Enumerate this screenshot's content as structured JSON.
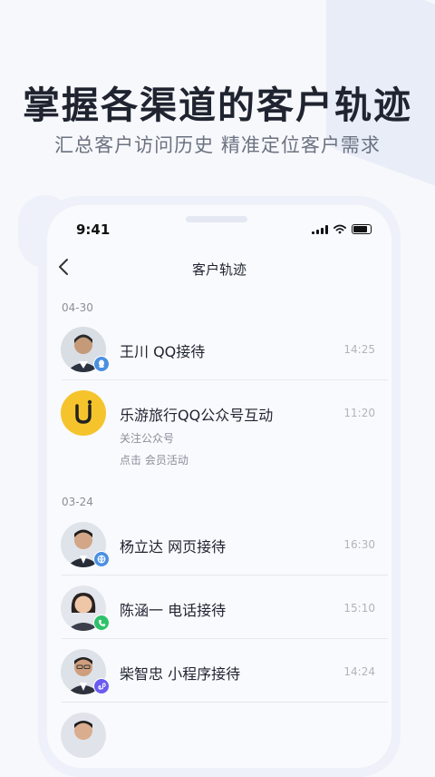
{
  "hero": {
    "title": "掌握各渠道的客户轨迹",
    "subtitle": "汇总客户访问历史 精准定位客户需求"
  },
  "status": {
    "time": "9:41"
  },
  "nav": {
    "back_icon": "chevron-left-icon",
    "title": "客户轨迹"
  },
  "groups": [
    {
      "date": "04-30",
      "items": [
        {
          "name": "王川 QQ接待",
          "time": "14:25",
          "channel": "qq-icon",
          "badge_color": "#4a90e2"
        },
        {
          "name": "乐游旅行QQ公众号互动",
          "time": "11:20",
          "detail1": "关注公众号",
          "detail2": "点击 会员活动",
          "logo_color": "#f5c42c"
        }
      ]
    },
    {
      "date": "03-24",
      "items": [
        {
          "name": "杨立达 网页接待",
          "time": "16:30",
          "channel": "web-icon",
          "badge_color": "#4a90e2"
        },
        {
          "name": "陈涵一 电话接待",
          "time": "15:10",
          "channel": "phone-icon",
          "badge_color": "#2ec26a"
        },
        {
          "name": "柴智忠 小程序接待",
          "time": "14:24",
          "channel": "miniprogram-icon",
          "badge_color": "#6a5cf0"
        }
      ]
    }
  ]
}
